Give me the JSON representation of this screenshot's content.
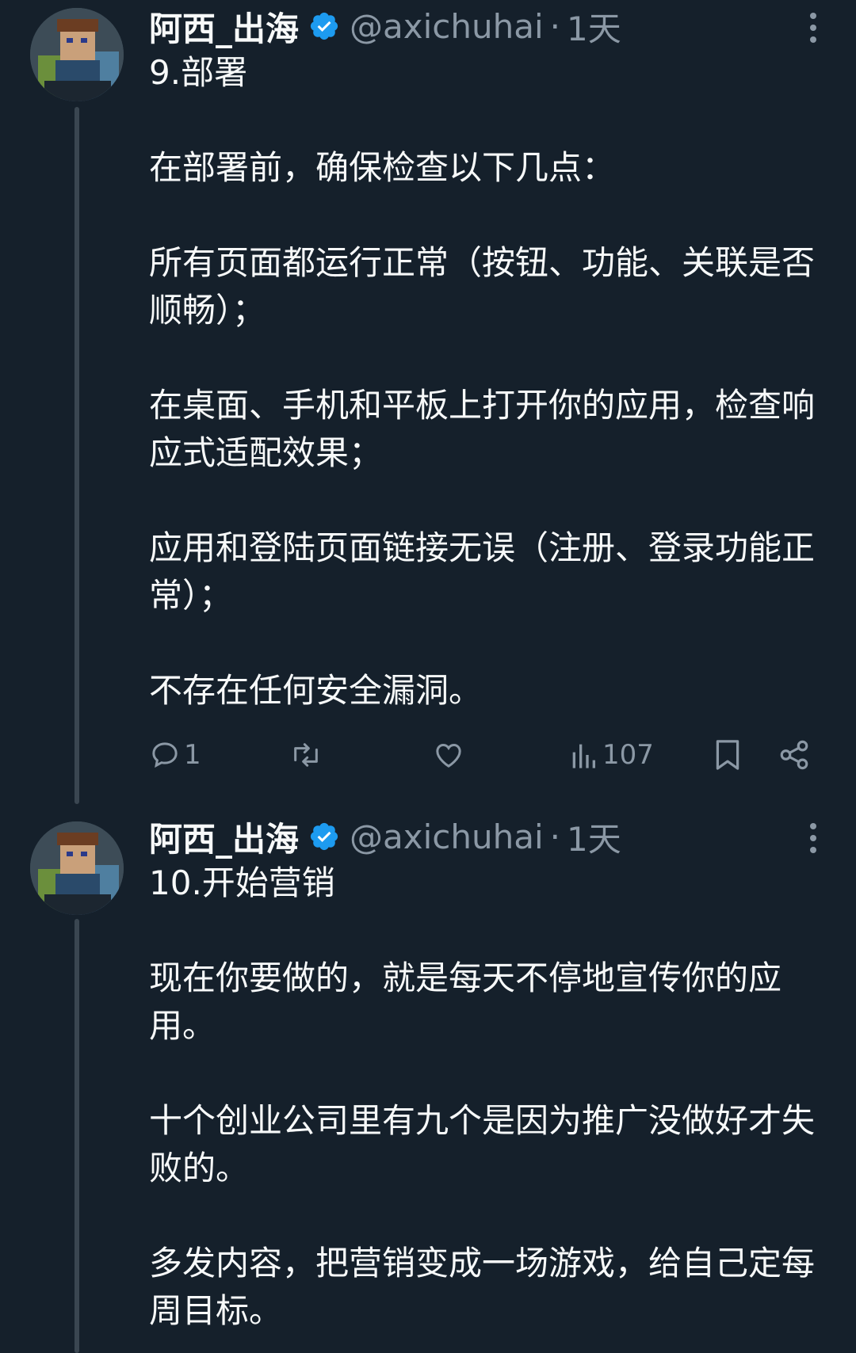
{
  "tweets": [
    {
      "author": {
        "name": "阿西_出海",
        "handle": "@axichuhai",
        "time": "1天",
        "separator": "·"
      },
      "title": "9.部署",
      "paragraphs": [
        "在部署前，确保检查以下几点：",
        "所有页面都运行正常（按钮、功能、关联是否顺畅）；",
        "在桌面、手机和平板上打开你的应用，检查响应式适配效果；",
        "应用和登陆页面链接无误（注册、登录功能正常）；",
        "不存在任何安全漏洞。"
      ],
      "stats": {
        "replies": "1",
        "views": "107"
      }
    },
    {
      "author": {
        "name": "阿西_出海",
        "handle": "@axichuhai",
        "time": "1天",
        "separator": "·"
      },
      "title": "10.开始营销",
      "paragraphs": [
        "现在你要做的，就是每天不停地宣传你的应用。",
        "十个创业公司里有九个是因为推广没做好才失败的。",
        "多发内容，把营销变成一场游戏，给自己定每周目标。"
      ]
    }
  ],
  "icons": {
    "more": "more-vertical-icon",
    "verified": "verified-badge-icon",
    "reply": "reply-icon",
    "retweet": "retweet-icon",
    "like": "heart-icon",
    "views": "views-chart-icon",
    "bookmark": "bookmark-icon",
    "share": "share-icon"
  },
  "colors": {
    "background": "#15202b",
    "text": "#f7f9f9",
    "muted": "#8b98a5",
    "verified": "#1d9bf0",
    "thread_line": "#3a4651"
  }
}
